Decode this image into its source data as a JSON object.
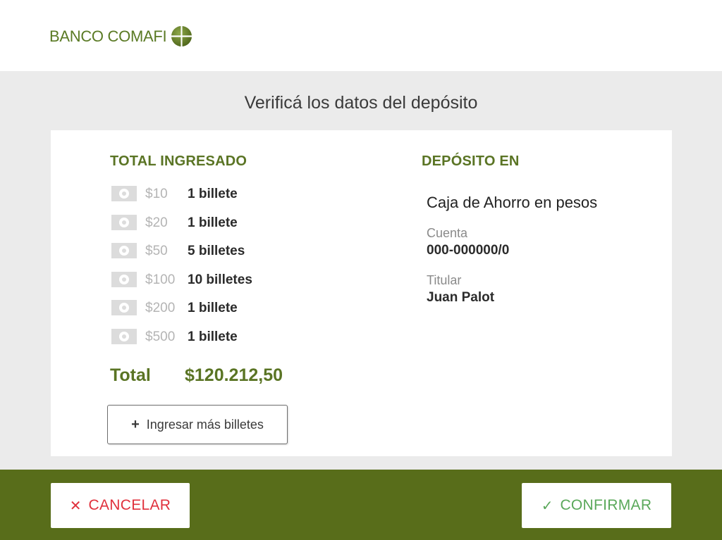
{
  "header": {
    "bank_name": "BANCO COMAFI",
    "logo_icon": "globe-icon",
    "brand_color": "#5a7a24"
  },
  "page": {
    "title": "Verificá los datos del depósito"
  },
  "left": {
    "section_title": "TOTAL INGRESADO",
    "bills": [
      {
        "icon": "banknote-icon",
        "denomination": "$10",
        "count": "1 billete"
      },
      {
        "icon": "banknote-icon",
        "denomination": "$20",
        "count": "1 billete"
      },
      {
        "icon": "banknote-icon",
        "denomination": "$50",
        "count": "5 billetes"
      },
      {
        "icon": "banknote-icon",
        "denomination": "$100",
        "count": "10 billetes"
      },
      {
        "icon": "banknote-icon",
        "denomination": "$200",
        "count": "1 billete"
      },
      {
        "icon": "banknote-icon",
        "denomination": "$500",
        "count": "1 billete"
      }
    ],
    "total_label": "Total",
    "total_value": "$120.212,50",
    "add_button": {
      "icon": "plus-icon",
      "label": "Ingresar más billetes"
    }
  },
  "right": {
    "section_title": "DEPÓSITO EN",
    "account_type": "Caja de Ahorro en pesos",
    "cuenta_label": "Cuenta",
    "cuenta_value": "000-000000/0",
    "titular_label": "Titular",
    "titular_value": "Juan Palot"
  },
  "footer": {
    "background_color": "#586d1a",
    "cancel": {
      "icon": "close-icon",
      "label": "CANCELAR",
      "color": "#e0303c"
    },
    "confirm": {
      "icon": "check-icon",
      "label": "CONFIRMAR",
      "color": "#5aa85a"
    }
  }
}
